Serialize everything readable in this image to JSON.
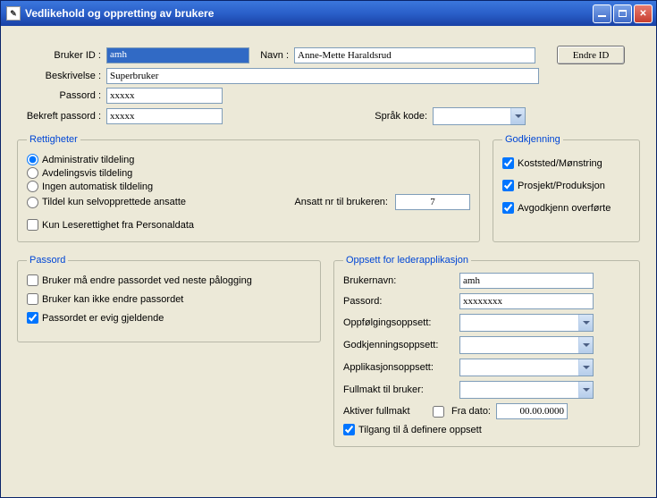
{
  "window": {
    "title": "Vedlikehold og oppretting av brukere"
  },
  "header": {
    "bruker_id_label": "Bruker ID :",
    "bruker_id_value": "amh",
    "navn_label": "Navn :",
    "navn_value": "Anne-Mette Haraldsrud",
    "endre_id_button": "Endre ID",
    "beskrivelse_label": "Beskrivelse :",
    "beskrivelse_value": "Superbruker",
    "passord_label": "Passord :",
    "passord_value": "xxxxx",
    "bekreft_label": "Bekreft passord :",
    "bekreft_value": "xxxxx",
    "sprak_label": "Språk kode:",
    "sprak_value": ""
  },
  "rettigheter": {
    "legend": "Rettigheter",
    "r1": "Administrativ tildeling",
    "r2": "Avdelingsvis tildeling",
    "r3": "Ingen automatisk tildeling",
    "r4": "Tildel kun selvopprettede ansatte",
    "kunlese": "Kun Leserettighet fra Personaldata",
    "ansattnr_label": "Ansatt nr til brukeren:",
    "ansattnr_value": "7"
  },
  "godkjenning": {
    "legend": "Godkjenning",
    "g1": "Koststed/Mønstring",
    "g2": "Prosjekt/Produksjon",
    "g3": "Avgodkjenn overførte"
  },
  "passord_section": {
    "legend": "Passord",
    "p1": "Bruker må endre passordet ved neste pålogging",
    "p2": "Bruker kan ikke endre passordet",
    "p3": "Passordet er evig gjeldende"
  },
  "leder": {
    "legend": "Oppsett for lederapplikasjon",
    "brukernavn_label": "Brukernavn:",
    "brukernavn_value": "amh",
    "passord_label": "Passord:",
    "passord_value": "xxxxxxxx",
    "oppfolg_label": "Oppfølgingsoppsett:",
    "oppfolg_value": "",
    "godkj_label": "Godkjenningsoppsett:",
    "godkj_value": "",
    "app_label": "Applikasjonsoppsett:",
    "app_value": "",
    "fullmakt_label": "Fullmakt til bruker:",
    "fullmakt_value": "",
    "aktiver_label": "Aktiver fullmakt",
    "fradato_label": "Fra dato:",
    "fradato_value": "00.00.0000",
    "tilgang_label": "Tilgang til å definere oppsett"
  }
}
